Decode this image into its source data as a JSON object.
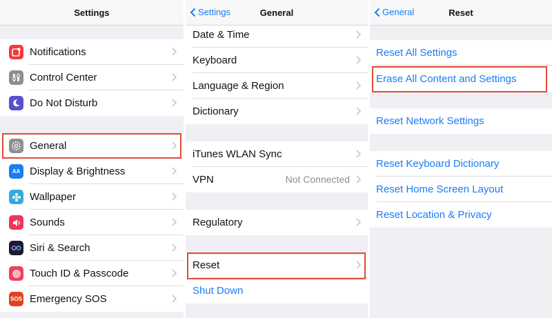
{
  "settings_panel": {
    "title": "Settings",
    "items": [
      {
        "label": "Notifications",
        "icon": "notifications-icon",
        "color": "#f4393a"
      },
      {
        "label": "Control Center",
        "icon": "control-center-icon",
        "color": "#8e8e93"
      },
      {
        "label": "Do Not Disturb",
        "icon": "moon-icon",
        "color": "#5a4fcf"
      },
      {
        "label": "General",
        "icon": "gear-icon",
        "color": "#8e8e93"
      },
      {
        "label": "Display & Brightness",
        "icon": "display-brightness-icon",
        "color": "#1a7cf5"
      },
      {
        "label": "Wallpaper",
        "icon": "wallpaper-icon",
        "color": "#36aadc"
      },
      {
        "label": "Sounds",
        "icon": "sounds-icon",
        "color": "#f0355d"
      },
      {
        "label": "Siri & Search",
        "icon": "siri-icon",
        "color": "#1b1b2f"
      },
      {
        "label": "Touch ID & Passcode",
        "icon": "fingerprint-icon",
        "color": "#f2405a"
      },
      {
        "label": "Emergency SOS",
        "icon": "sos-icon",
        "color": "#e2421f"
      }
    ],
    "sos_icon_text": "SOS",
    "display_icon_text": "AA"
  },
  "general_panel": {
    "back_label": "Settings",
    "title": "General",
    "items": [
      {
        "label": "Date & Time"
      },
      {
        "label": "Keyboard"
      },
      {
        "label": "Language & Region"
      },
      {
        "label": "Dictionary"
      },
      {
        "label": "iTunes WLAN Sync"
      },
      {
        "label": "VPN",
        "value": "Not Connected"
      },
      {
        "label": "Regulatory"
      },
      {
        "label": "Reset"
      },
      {
        "label": "Shut Down"
      }
    ]
  },
  "reset_panel": {
    "back_label": "General",
    "title": "Reset",
    "items": [
      {
        "label": "Reset All Settings"
      },
      {
        "label": "Erase All Content and Settings"
      },
      {
        "label": "Reset Network Settings"
      },
      {
        "label": "Reset Keyboard Dictionary"
      },
      {
        "label": "Reset Home Screen Layout"
      },
      {
        "label": "Reset Location & Privacy"
      }
    ]
  },
  "colors": {
    "accent": "#1a7cf5",
    "highlight": "#e24a35",
    "group_background": "#efeff4"
  }
}
